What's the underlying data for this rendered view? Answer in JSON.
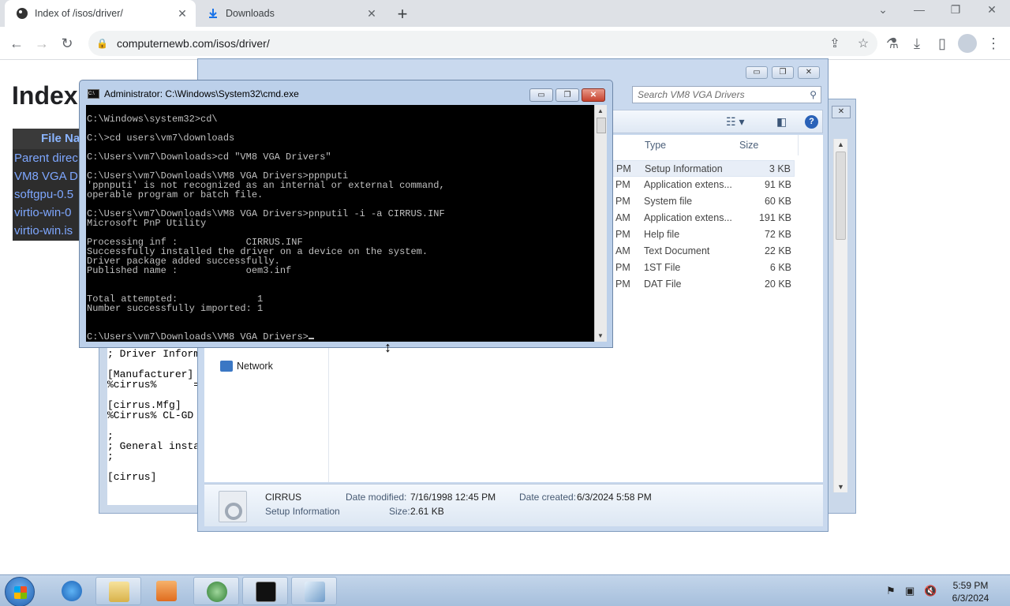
{
  "browser": {
    "tabs": [
      {
        "title": "Index of /isos/driver/",
        "active": true
      },
      {
        "title": "Downloads",
        "active": false
      }
    ],
    "url": "computernewb.com/isos/driver/"
  },
  "page": {
    "title": "Index",
    "table_header": "File Na",
    "links": [
      "Parent direc",
      "VM8 VGA D",
      "softgpu-0.5",
      "virtio-win-0",
      "virtio-win.is"
    ]
  },
  "notepad": {
    "text": "; Driver Inform\n\n[Manufacturer]\n%cirrus%      =\n\n[cirrus.Mfg]\n%Cirrus% CL-GD\n\n;\n; General insta\n;\n\n[cirrus]"
  },
  "explorer": {
    "search_placeholder": "Search VM8 VGA Drivers",
    "columns": {
      "type": "Type",
      "size": "Size"
    },
    "nav_network": "Network",
    "rows": [
      {
        "time": "PM",
        "type": "Setup Information",
        "size": "3 KB",
        "selected": true
      },
      {
        "time": "PM",
        "type": "Application extens...",
        "size": "91 KB"
      },
      {
        "time": "PM",
        "type": "System file",
        "size": "60 KB"
      },
      {
        "time": "AM",
        "type": "Application extens...",
        "size": "191 KB"
      },
      {
        "time": "PM",
        "type": "Help file",
        "size": "72 KB"
      },
      {
        "time": "AM",
        "type": "Text Document",
        "size": "22 KB"
      },
      {
        "time": "PM",
        "type": "1ST File",
        "size": "6 KB"
      },
      {
        "time": "PM",
        "type": "DAT File",
        "size": "20 KB"
      }
    ],
    "details": {
      "name": "CIRRUS",
      "kind": "Setup Information",
      "date_modified_label": "Date modified:",
      "date_modified": "7/16/1998 12:45 PM",
      "size_label": "Size:",
      "size": "2.61 KB",
      "date_created_label": "Date created:",
      "date_created": "6/3/2024 5:58 PM"
    }
  },
  "cmd": {
    "title": "Administrator: C:\\Windows\\System32\\cmd.exe",
    "output": "C:\\Windows\\system32>cd\\\n\nC:\\>cd users\\vm7\\downloads\n\nC:\\Users\\vm7\\Downloads>cd \"VM8 VGA Drivers\"\n\nC:\\Users\\vm7\\Downloads\\VM8 VGA Drivers>ppnputi\n'ppnputi' is not recognized as an internal or external command,\noperable program or batch file.\n\nC:\\Users\\vm7\\Downloads\\VM8 VGA Drivers>pnputil -i -a CIRRUS.INF\nMicrosoft PnP Utility\n\nProcessing inf :            CIRRUS.INF\nSuccessfully installed the driver on a device on the system.\nDriver package added successfully.\nPublished name :            oem3.inf\n\n\nTotal attempted:              1\nNumber successfully imported: 1\n\n\nC:\\Users\\vm7\\Downloads\\VM8 VGA Drivers>"
  },
  "taskbar": {
    "time": "5:59 PM",
    "date": "6/3/2024"
  },
  "colors": {
    "chrome_tabstrip": "#dee1e6",
    "console_bg": "#000000",
    "console_fg": "#c0c0c0",
    "taskbar": "#b4c9e3",
    "link": "#7ea7ff"
  }
}
